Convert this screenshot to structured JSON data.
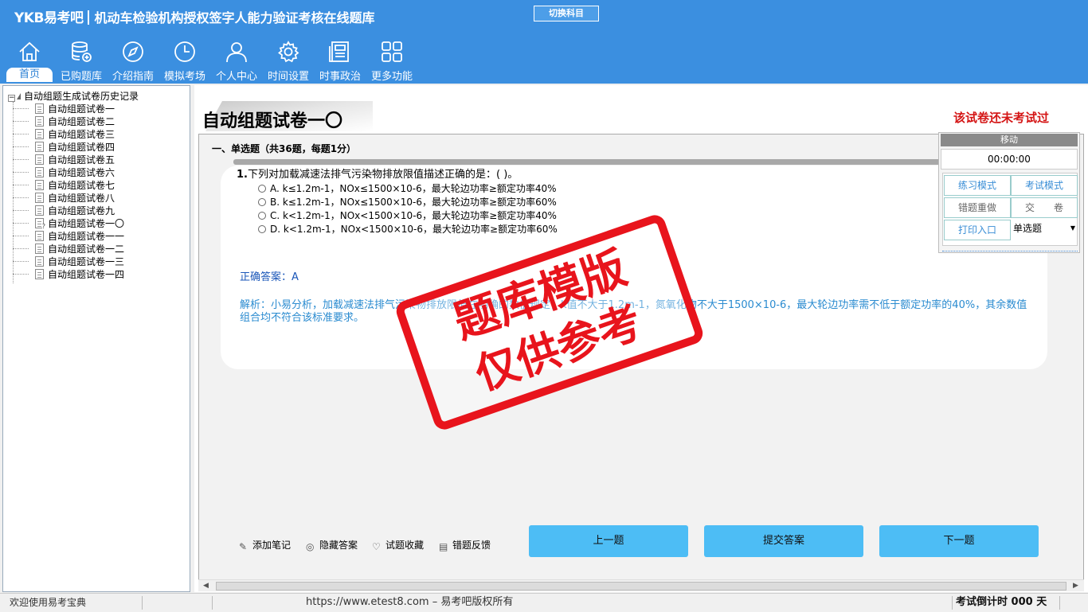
{
  "app": {
    "logo": "YKB易考吧",
    "title": "机动车检验机构授权签字人能力验证考核在线题库",
    "switch_subject": "切换科目"
  },
  "nav": [
    {
      "label": "首页",
      "icon": "home-icon",
      "active": true
    },
    {
      "label": "已购题库",
      "icon": "database-icon"
    },
    {
      "label": "介绍指南",
      "icon": "compass-icon"
    },
    {
      "label": "模拟考场",
      "icon": "clock-icon"
    },
    {
      "label": "个人中心",
      "icon": "user-icon"
    },
    {
      "label": "时间设置",
      "icon": "gear-icon"
    },
    {
      "label": "时事政治",
      "icon": "news-icon"
    },
    {
      "label": "更多功能",
      "icon": "grid-icon"
    }
  ],
  "tree": {
    "root": "自动组题生成试卷历史记录",
    "items": [
      "自动组题试卷一",
      "自动组题试卷二",
      "自动组题试卷三",
      "自动组题试卷四",
      "自动组题试卷五",
      "自动组题试卷六",
      "自动组题试卷七",
      "自动组题试卷八",
      "自动组题试卷九",
      "自动组题试卷一〇",
      "自动组题试卷一一",
      "自动组题试卷一二",
      "自动组题试卷一三",
      "自动组题试卷一四"
    ]
  },
  "paper": {
    "title": "自动组题试卷一〇",
    "status": "该试卷还未考试过",
    "section": "一、单选题（共36题，每题1分）"
  },
  "question": {
    "number": "1.",
    "text": "下列对加载减速法排气污染物排放限值描述正确的是：( )。",
    "options": [
      "A. k≤1.2m-1，NOx≤1500×10-6，最大轮边功率≥额定功率40%",
      "B. k≤1.2m-1，NOx≤1500×10-6，最大轮边功率≥额定功率60%",
      "C. k<1.2m-1，NOx<1500×10-6，最大轮边功率≥额定功率40%",
      "D. k<1.2m-1，NOx<1500×10-6，最大轮边功率≥额定功率60%"
    ],
    "answer": "正确答案：A",
    "analysis": "解析：小易分析，加载减速法排气污染物排放限值在明确的数值规定，k值不大于1.2m-1，氮氧化物不大于1500×10-6，最大轮边功率需不低于额定功率的40%，其余数值组合均不符合该标准要求。"
  },
  "tools": [
    {
      "label": "添加笔记",
      "icon": "pencil-icon"
    },
    {
      "label": "隐藏答案",
      "icon": "eye-icon"
    },
    {
      "label": "试题收藏",
      "icon": "heart-icon"
    },
    {
      "label": "错题反馈",
      "icon": "feedback-icon"
    }
  ],
  "buttons": {
    "prev": "上一题",
    "submit": "提交答案",
    "next": "下一题"
  },
  "panel": {
    "move": "移动",
    "timer": "00:00:00",
    "practice_mode": "练习模式",
    "exam_mode": "考试模式",
    "redo_wrong": "错题重做",
    "hand_in": "交　　卷",
    "print": "打印入口",
    "type_select": "单选题"
  },
  "stamp": {
    "line1": "题库模版",
    "line2": "仅供参考"
  },
  "statusbar": {
    "welcome": "欢迎使用易考宝典",
    "url": "https://www.etest8.com",
    "copyright": " – 易考吧版权所有",
    "countdown": "考试倒计时 000 天"
  },
  "colors": {
    "header": "#3b8fe0",
    "button": "#4dbdf5",
    "status_red": "#d41414",
    "stamp_red": "#e8141c"
  }
}
